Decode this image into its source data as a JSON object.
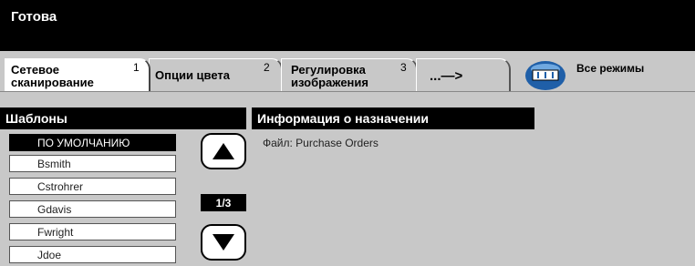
{
  "status": {
    "text": "Готова"
  },
  "tabs": [
    {
      "label": "Сетевое\nсканирование",
      "number": "1"
    },
    {
      "label": "Опции цвета",
      "number": "2"
    },
    {
      "label": "Регулировка\nизображения",
      "number": "3"
    },
    {
      "label": "...—>"
    }
  ],
  "all_modes": {
    "label": "Все режимы",
    "icon": "all-modes-icon"
  },
  "templates": {
    "title": "Шаблоны",
    "items": [
      "ПО УМОЛЧАНИЮ",
      "Bsmith",
      "Cstrohrer",
      "Gdavis",
      "Fwright",
      "Jdoe"
    ],
    "selected_index": 0,
    "page": "1/3"
  },
  "destination": {
    "title": "Информация о назначении",
    "file_line": "Файл: Purchase Orders"
  },
  "colors": {
    "header": "#000000",
    "panel_bg": "#c8c8c8",
    "selected": "#000000"
  }
}
